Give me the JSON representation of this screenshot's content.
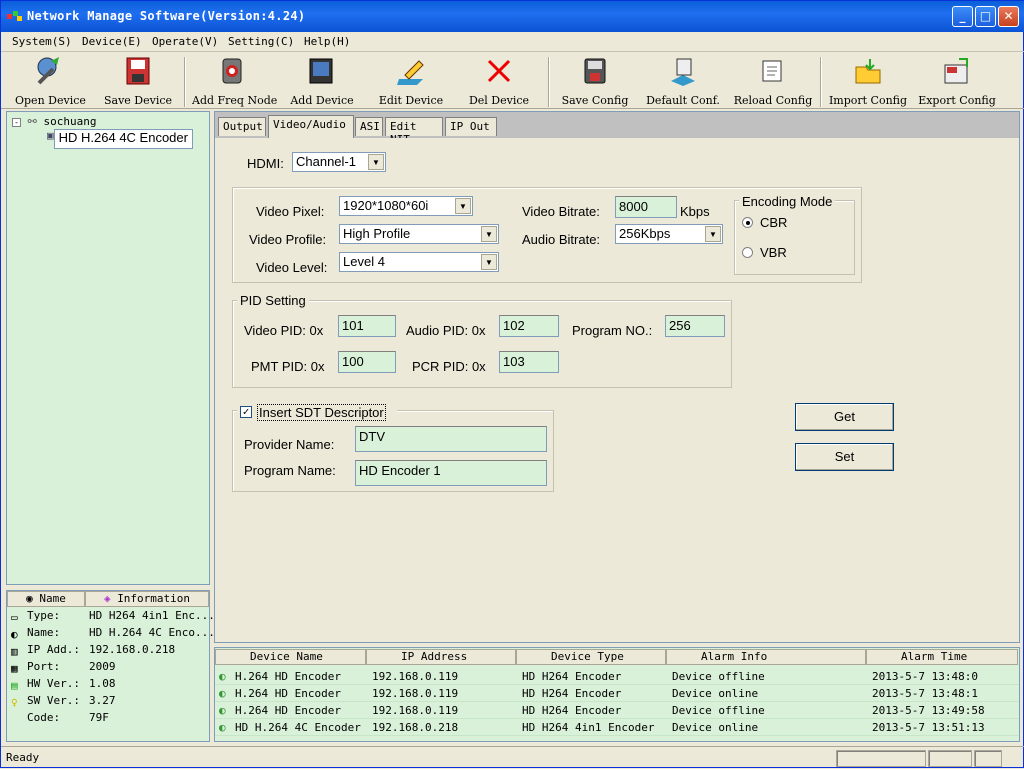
{
  "window": {
    "title": "Network Manage Software(Version:4.24)",
    "minimize": "_",
    "maximize": "□",
    "close": "✕"
  },
  "menu": [
    "System(S)",
    "Device(E)",
    "Operate(V)",
    "Setting(C)",
    "Help(H)"
  ],
  "toolbar": [
    "Open Device",
    "Save Device",
    "Add Freq Node",
    "Add Device",
    "Edit Device",
    "Del Device",
    "Save Config",
    "Default Conf.",
    "Reload Config",
    "Import Config",
    "Export Config"
  ],
  "tree": {
    "root": "sochuang",
    "child": "HD H.264 4C Encoder"
  },
  "info": {
    "headers": [
      "Name",
      "Information"
    ],
    "rows": [
      {
        "k": "Type:",
        "v": "HD H264 4in1 Enc..."
      },
      {
        "k": "Name:",
        "v": "HD H.264 4C Enco..."
      },
      {
        "k": "IP Add.:",
        "v": "192.168.0.218"
      },
      {
        "k": "Port:",
        "v": "2009"
      },
      {
        "k": "HW Ver.:",
        "v": "1.08"
      },
      {
        "k": "SW Ver.:",
        "v": "3.27"
      },
      {
        "k": "Code:",
        "v": "79F"
      }
    ]
  },
  "tabs": [
    "Output",
    "Video/Audio",
    "ASI",
    "Edit NIT",
    "IP Out"
  ],
  "form": {
    "hdmi_label": "HDMI:",
    "hdmi_value": "Channel-1",
    "video_pixel_label": "Video Pixel:",
    "video_pixel_value": "1920*1080*60i",
    "video_profile_label": "Video Profile:",
    "video_profile_value": "High Profile",
    "video_level_label": "Video Level:",
    "video_level_value": "Level 4",
    "video_bitrate_label": "Video Bitrate:",
    "video_bitrate_value": "8000",
    "kbps": "Kbps",
    "audio_bitrate_label": "Audio Bitrate:",
    "audio_bitrate_value": "256Kbps",
    "encoding_mode_label": "Encoding Mode",
    "cbr": "CBR",
    "vbr": "VBR",
    "pid_setting_label": "PID Setting",
    "video_pid_label": "Video PID: 0x",
    "video_pid": "101",
    "audio_pid_label": "Audio PID: 0x",
    "audio_pid": "102",
    "program_no_label": "Program NO.:",
    "program_no": "256",
    "pmt_pid_label": "PMT PID: 0x",
    "pmt_pid": "100",
    "pcr_pid_label": "PCR PID: 0x",
    "pcr_pid": "103",
    "sdt_label": "Insert SDT Descriptor",
    "check": "✓",
    "provider_label": "Provider Name:",
    "provider": "DTV",
    "program_name_label": "Program Name:",
    "program_name": "HD Encoder 1",
    "get": "Get",
    "set": "Set"
  },
  "alarm": {
    "headers": [
      "Device Name",
      "IP Address",
      "Device Type",
      "Alarm Info",
      "Alarm Time"
    ],
    "rows": [
      [
        "H.264 HD Encoder",
        "192.168.0.119",
        "HD H264 Encoder",
        "Device offline",
        "2013-5-7 13:48:0"
      ],
      [
        "H.264 HD Encoder",
        "192.168.0.119",
        "HD H264 Encoder",
        "Device online",
        "2013-5-7 13:48:1"
      ],
      [
        "H.264 HD Encoder",
        "192.168.0.119",
        "HD H264 Encoder",
        "Device offline",
        "2013-5-7 13:49:58"
      ],
      [
        "HD H.264 4C Encoder",
        "192.168.0.218",
        "HD H264 4in1 Encoder",
        "Device online",
        "2013-5-7 13:51:13"
      ]
    ]
  },
  "status": "Ready"
}
